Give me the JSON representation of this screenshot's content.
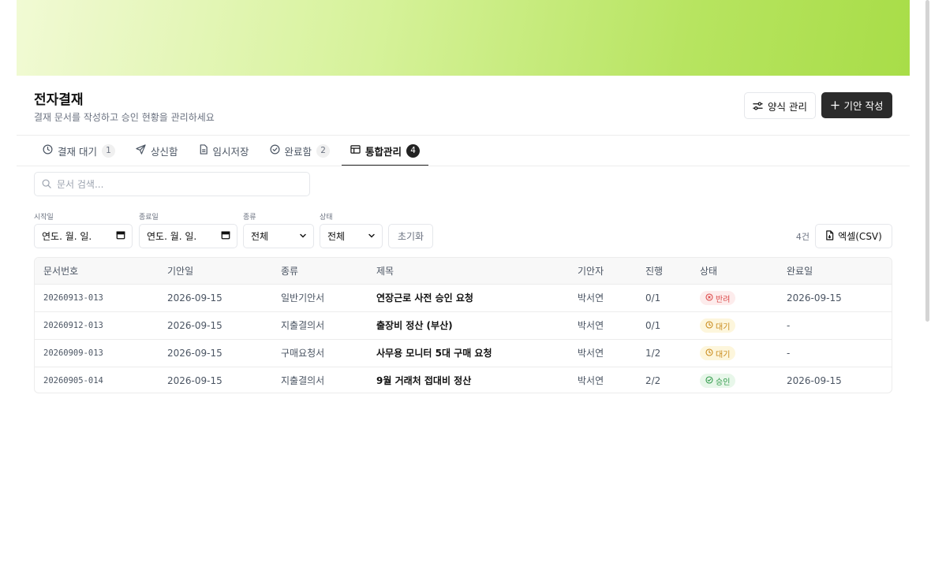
{
  "header": {
    "title": "전자결재",
    "subtitle": "결재 문서를 작성하고 승인 현황을 관리하세요",
    "manage_forms_label": "양식 관리",
    "new_draft_label": "기안 작성"
  },
  "tabs": [
    {
      "label": "결재 대기",
      "count": "1",
      "icon": "clock-icon"
    },
    {
      "label": "상신함",
      "count": "",
      "icon": "send-icon"
    },
    {
      "label": "임시저장",
      "count": "",
      "icon": "file-icon"
    },
    {
      "label": "완료함",
      "count": "2",
      "icon": "check-circle-icon"
    },
    {
      "label": "통합관리",
      "count": "4",
      "icon": "table-icon",
      "active": true
    }
  ],
  "search": {
    "placeholder": "문서 검색..."
  },
  "filters": {
    "start_label": "시작일",
    "start_value": "연도. 월. 일.",
    "end_label": "종료일",
    "end_value": "연도. 월. 일.",
    "type_label": "종류",
    "type_value": "전체",
    "status_label": "상태",
    "status_value": "전체",
    "reset_label": "초기화"
  },
  "result_count": "4건",
  "export_label": "엑셀(CSV)",
  "table": {
    "columns": [
      "문서번호",
      "기안일",
      "종류",
      "제목",
      "기안자",
      "진행",
      "상태",
      "완료일"
    ],
    "rows": [
      {
        "doc_no": "20260913-013",
        "draft_date": "2026-09-15",
        "type": "일반기안서",
        "title": "연장근로 사전 승인 요청",
        "drafter": "박서연",
        "progress": "0/1",
        "status": "반려",
        "status_kind": "rejected",
        "done_date": "2026-09-15"
      },
      {
        "doc_no": "20260912-013",
        "draft_date": "2026-09-15",
        "type": "지출결의서",
        "title": "출장비 정산 (부산)",
        "drafter": "박서연",
        "progress": "0/1",
        "status": "대기",
        "status_kind": "pending",
        "done_date": "-"
      },
      {
        "doc_no": "20260909-013",
        "draft_date": "2026-09-15",
        "type": "구매요청서",
        "title": "사무용 모니터 5대 구매 요청",
        "drafter": "박서연",
        "progress": "1/2",
        "status": "대기",
        "status_kind": "pending",
        "done_date": "-"
      },
      {
        "doc_no": "20260905-014",
        "draft_date": "2026-09-15",
        "type": "지출결의서",
        "title": "9월 거래처 접대비 정산",
        "drafter": "박서연",
        "progress": "2/2",
        "status": "승인",
        "status_kind": "approved",
        "done_date": "2026-09-15"
      }
    ]
  },
  "colors": {
    "banner_start": "#f1fad4",
    "banner_end": "#a8dd48",
    "primary_button": "#2b2b2b",
    "rejected": "#dc4a4a",
    "pending": "#c98a1a",
    "approved": "#2f9a48"
  }
}
